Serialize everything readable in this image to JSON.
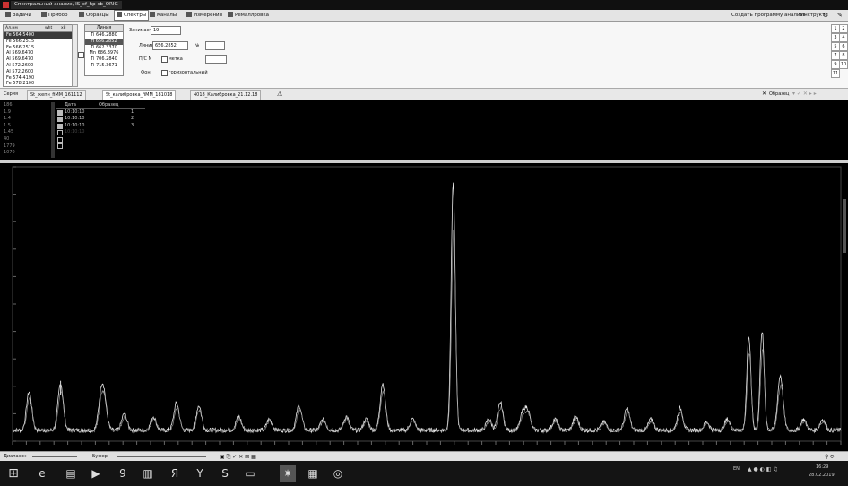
{
  "window": {
    "title": "Спектральный анализ, IS_cf_hp-sb_ORIG"
  },
  "menu": {
    "items": [
      "Задачи",
      "Прибор",
      "Образцы",
      "Спектры",
      "Каналы",
      "Измерения",
      "Ремаллровка"
    ],
    "selected_index": 3,
    "right_link": "Создать программу анализа",
    "help": "Инструкт"
  },
  "elements_list": {
    "headers": [
      "Ал.нм",
      "wht",
      "x8"
    ],
    "items": [
      "Fe 564.5400",
      "Fe 566.2515",
      "Fe 566.2515",
      "Al 569.6470",
      "Al 569.6470",
      "Al 572.2600",
      "Al 572.2600",
      "Fe 574.4190",
      "Fe 578.2100"
    ],
    "selected_index": 0
  },
  "lines_list": {
    "header": "Линия",
    "items": [
      "Ti 646.2880",
      "H 656.2852",
      "Ti 662.3370",
      "Mn 686.3976",
      "Ti 706.2840",
      "Ti 715.3671"
    ],
    "selected_index": 1
  },
  "params": {
    "zanimaet_label": "Занимает",
    "zanimaet_value": "19",
    "line_label": "Линия",
    "line_value": "656.2852",
    "n_label": "№",
    "n_value": "",
    "pls_label": "П/С N",
    "pls_checkbox": "метка",
    "pls_value": "",
    "fon_label": "Фон",
    "fon_checkbox": "горизонтальный"
  },
  "number_grid": [
    "1",
    "2",
    "3",
    "4",
    "5",
    "6",
    "7",
    "8",
    "9",
    "10",
    "11"
  ],
  "tabs": {
    "items": [
      "Серия",
      "St_жепн_fiMM_161112",
      "St_калибровка_fiMM_181018",
      "4018_Калибровка_21.12.18"
    ],
    "selected_index": 2,
    "right_label": "Образец"
  },
  "series_list": [
    "186",
    "1.9",
    "1.4",
    "1.5",
    "1.45",
    "40",
    "1779",
    "1070"
  ],
  "series_table": {
    "headers": [
      "Дата",
      "Образец"
    ],
    "rows": [
      {
        "time": "10:10:10",
        "sample": "1",
        "checked": true,
        "dim": false
      },
      {
        "time": "10:10:10",
        "sample": "2",
        "checked": true,
        "dim": false
      },
      {
        "time": "10:10:10",
        "sample": "3",
        "checked": true,
        "dim": false
      },
      {
        "time": "10:10:10",
        "sample": "",
        "checked": false,
        "dim": true
      },
      {
        "time": "",
        "sample": "",
        "checked": false,
        "dim": true
      },
      {
        "time": "",
        "sample": "",
        "checked": false,
        "dim": true
      }
    ]
  },
  "chart_data": {
    "type": "line",
    "title": "",
    "xlabel": "",
    "ylabel": "",
    "xlim": [
      0,
      100
    ],
    "ylim": [
      0,
      100
    ],
    "grid": false,
    "legend": "none",
    "baseline": 4,
    "peaks": [
      [
        2.0,
        14
      ],
      [
        5.8,
        17
      ],
      [
        10.7,
        12
      ],
      [
        11.1,
        9
      ],
      [
        13.5,
        6
      ],
      [
        17.0,
        5
      ],
      [
        19.8,
        10
      ],
      [
        22.5,
        9
      ],
      [
        27.3,
        5
      ],
      [
        31.0,
        4
      ],
      [
        34.6,
        9
      ],
      [
        37.5,
        4
      ],
      [
        40.3,
        5
      ],
      [
        42.7,
        4
      ],
      [
        44.7,
        17
      ],
      [
        48.3,
        4
      ],
      [
        53.2,
        90
      ],
      [
        57.5,
        4
      ],
      [
        58.9,
        10
      ],
      [
        61.6,
        6
      ],
      [
        62.2,
        7
      ],
      [
        65.5,
        4
      ],
      [
        68.0,
        5
      ],
      [
        71.4,
        3
      ],
      [
        74.2,
        8
      ],
      [
        77.1,
        4
      ],
      [
        80.6,
        8
      ],
      [
        83.8,
        3
      ],
      [
        86.3,
        4
      ],
      [
        88.9,
        34
      ],
      [
        90.5,
        36
      ],
      [
        92.7,
        20
      ],
      [
        95.5,
        4
      ],
      [
        97.8,
        4
      ]
    ],
    "series": [
      {
        "values_note_key": "main",
        "color": "#e8e8e8"
      },
      {
        "values_note_key": "secondary",
        "color": "#9a9a9a"
      }
    ]
  },
  "status": {
    "dispersion_label": "Диапазон",
    "buffer_label": "Буфер"
  },
  "taskbar": {
    "lang": "EN",
    "time": "16:29",
    "date": "28.02.2019"
  }
}
